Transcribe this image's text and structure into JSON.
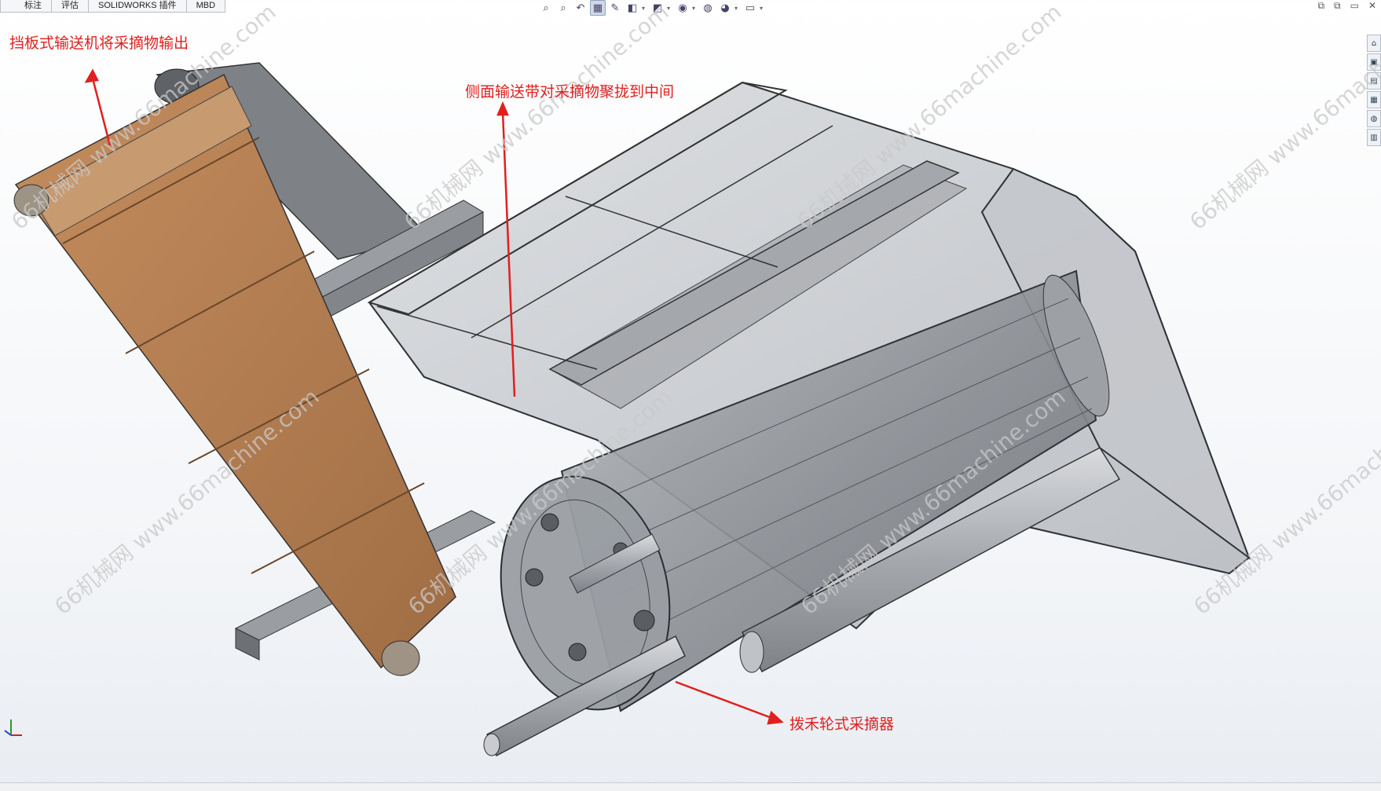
{
  "tabs": [
    "标注",
    "评估",
    "SOLIDWORKS 插件",
    "MBD"
  ],
  "toolbar": {
    "buttons": [
      {
        "icon": "zoom-to-fit-icon",
        "glyph": "⌕",
        "drop": false,
        "active": false
      },
      {
        "icon": "zoom-to-area-icon",
        "glyph": "⌕",
        "drop": false,
        "active": false
      },
      {
        "icon": "previous-view-icon",
        "glyph": "↶",
        "drop": false,
        "active": false
      },
      {
        "icon": "section-view-icon",
        "glyph": "▦",
        "drop": false,
        "active": true
      },
      {
        "icon": "dynamic-annotation-icon",
        "glyph": "✎",
        "drop": false,
        "active": false
      },
      {
        "icon": "view-orientation-icon",
        "glyph": "◧",
        "drop": true,
        "active": false
      },
      {
        "icon": "display-style-icon",
        "glyph": "◩",
        "drop": true,
        "active": false
      },
      {
        "icon": "hide-show-items-icon",
        "glyph": "◉",
        "drop": true,
        "active": false
      },
      {
        "icon": "edit-appearance-icon",
        "glyph": "◍",
        "drop": false,
        "active": false
      },
      {
        "icon": "apply-scene-icon",
        "glyph": "◕",
        "drop": true,
        "active": false
      },
      {
        "icon": "view-settings-icon",
        "glyph": "▭",
        "drop": true,
        "active": false
      }
    ]
  },
  "window_controls": [
    "⧉",
    "⧉",
    "▭",
    "✕"
  ],
  "task_pane_icons": [
    "⌂",
    "▣",
    "▤",
    "▦",
    "◍",
    "▥"
  ],
  "annotations": {
    "top_left": "挡板式输送机将采摘物输出",
    "top_center": "侧面输送带对采摘物聚拢到中间",
    "bottom": "拨禾轮式采摘器"
  },
  "watermark": {
    "text": "66机械网 www.66machine.com"
  },
  "colors": {
    "annotation": "#e0201f",
    "belt": "#b07a4f",
    "steel": "#8f9398",
    "watermark": "#c9c9c9"
  }
}
